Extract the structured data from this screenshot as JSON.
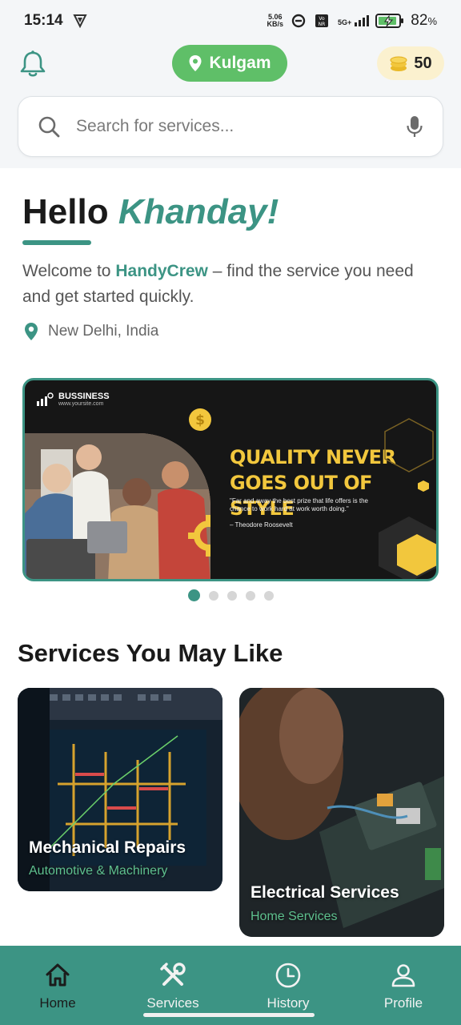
{
  "status_bar": {
    "time": "15:14",
    "net_speed_value": "5.06",
    "net_speed_unit": "KB/s",
    "network": "5G+",
    "battery": "82",
    "battery_unit": "%"
  },
  "header": {
    "location": "Kulgam",
    "coins": "50"
  },
  "search": {
    "placeholder": "Search for services..."
  },
  "greeting": {
    "hello": "Hello",
    "name": "Khanday!",
    "welcome_prefix": "Welcome to",
    "brand": "HandyCrew",
    "welcome_suffix": "– find the service you need and get started quickly.",
    "location": "New Delhi, India"
  },
  "banner": {
    "brand_name": "BUSSINESS",
    "brand_url": "www.yoursite.com",
    "headline_line1": "QUALITY NEVER",
    "headline_line2": "GOES OUT OF STYLE",
    "quote": "\"Far and away the best prize that life offers is the chance to work hard at work worth doing.\"",
    "author": "– Theodore Roosevelt",
    "slide_count": 5,
    "active_slide": 1
  },
  "services": {
    "title": "Services You May Like",
    "items": [
      {
        "title": "Mechanical Repairs",
        "subtitle": "Automotive & Machinery"
      },
      {
        "title": "Electrical Services",
        "subtitle": "Home Services"
      }
    ]
  },
  "nav": {
    "items": [
      {
        "label": "Home",
        "icon": "home-icon"
      },
      {
        "label": "Services",
        "icon": "tools-icon"
      },
      {
        "label": "History",
        "icon": "clock-icon"
      },
      {
        "label": "Profile",
        "icon": "person-icon"
      }
    ],
    "active": "Home"
  },
  "colors": {
    "primary": "#3c9484",
    "location_pill": "#5fbf68",
    "coin_pill": "#fbf1cf",
    "banner_accent": "#f2c73d",
    "card_subtitle": "#5ec08e"
  }
}
